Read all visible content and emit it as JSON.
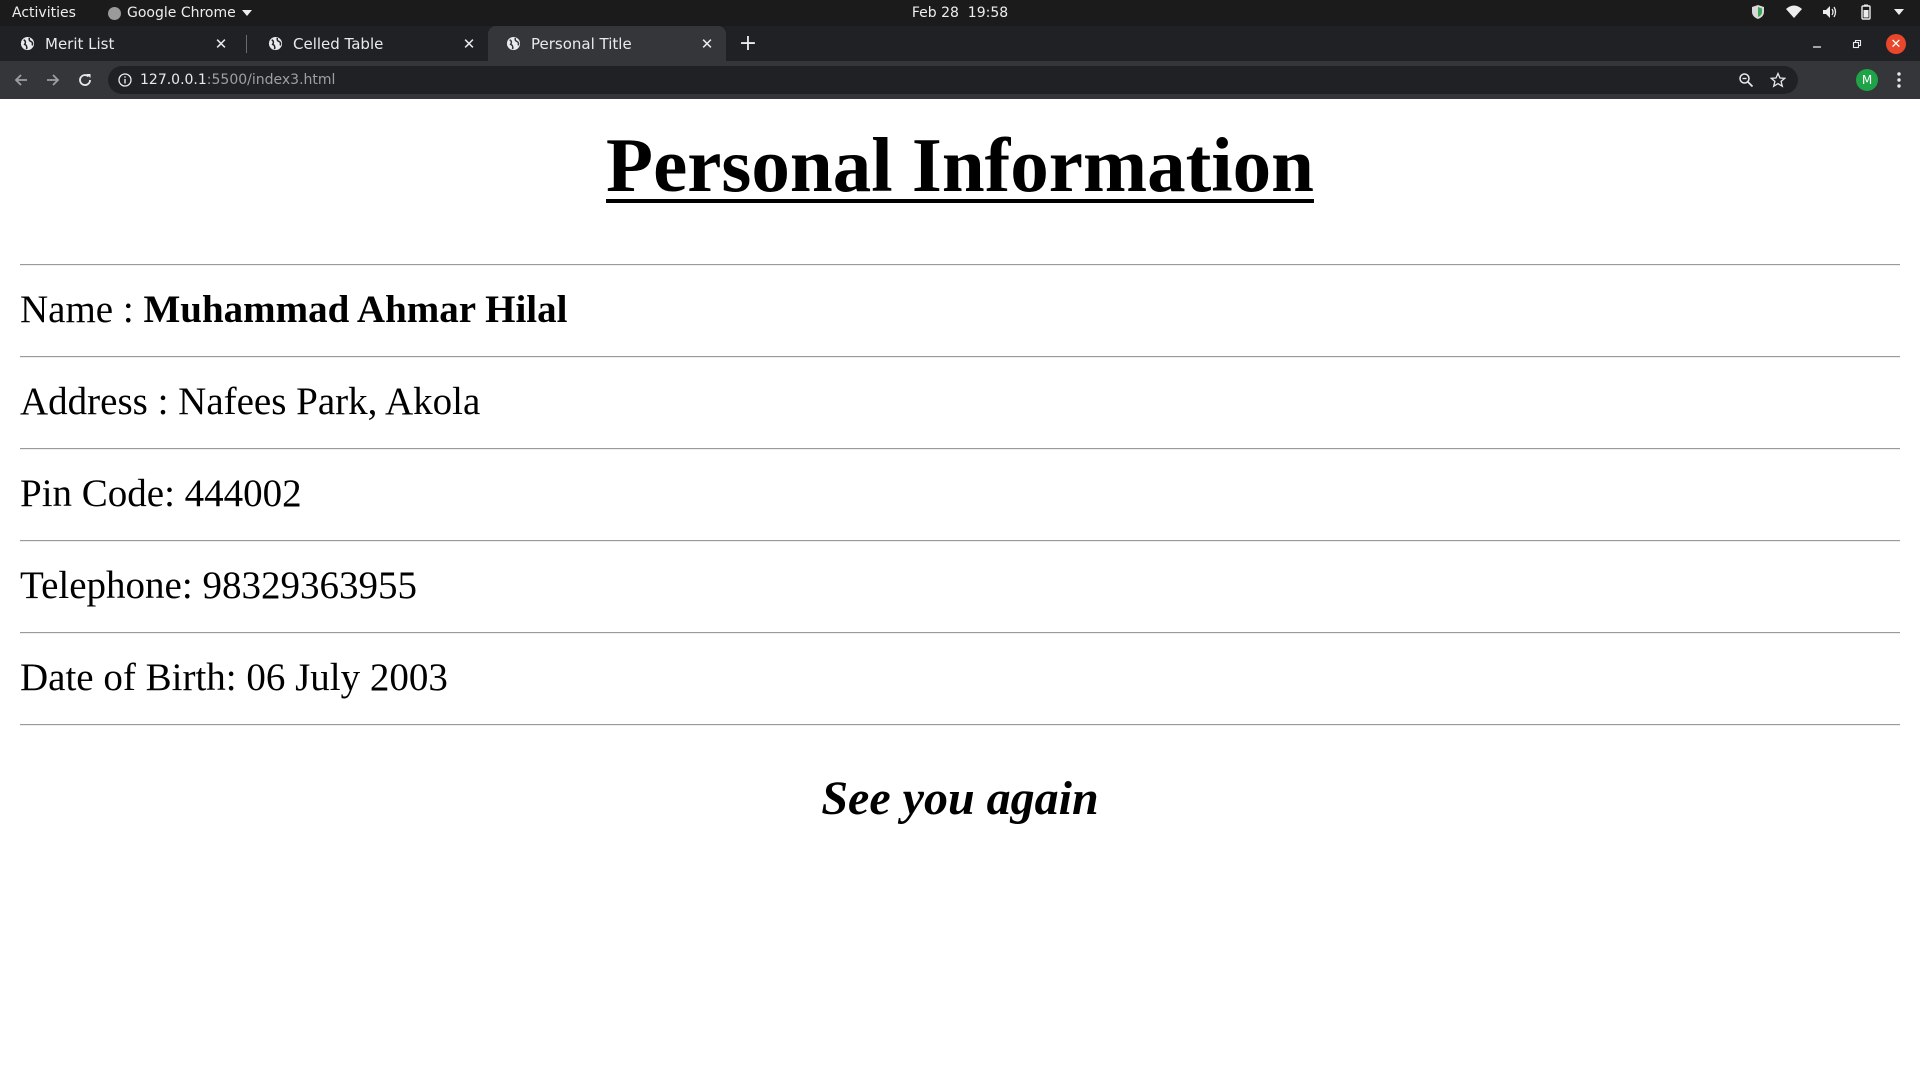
{
  "system_bar": {
    "activities": "Activities",
    "app_name": "Google Chrome",
    "clock_date": "Feb 28",
    "clock_time": "19:58"
  },
  "browser": {
    "tabs": [
      {
        "title": "Merit List",
        "active": false
      },
      {
        "title": "Celled Table",
        "active": false
      },
      {
        "title": "Personal Title",
        "active": true
      }
    ],
    "url_host": "127.0.0.1",
    "url_path": ":5500/index3.html",
    "profile_initial": "M",
    "colors": {
      "tabstrip": "#202124",
      "toolbar": "#35363a",
      "avatar": "#1ea446",
      "close_button": "#e8472b"
    }
  },
  "page": {
    "heading": "Personal Information",
    "name_label": "Name : ",
    "name_value": "Muhammad Ahmar Hilal",
    "address": "Address : Nafees Park, Akola",
    "pin_code": "Pin Code: 444002",
    "telephone": "Telephone: 98329363955",
    "dob": "Date of Birth: 06 July 2003",
    "farewell": "See you again"
  }
}
